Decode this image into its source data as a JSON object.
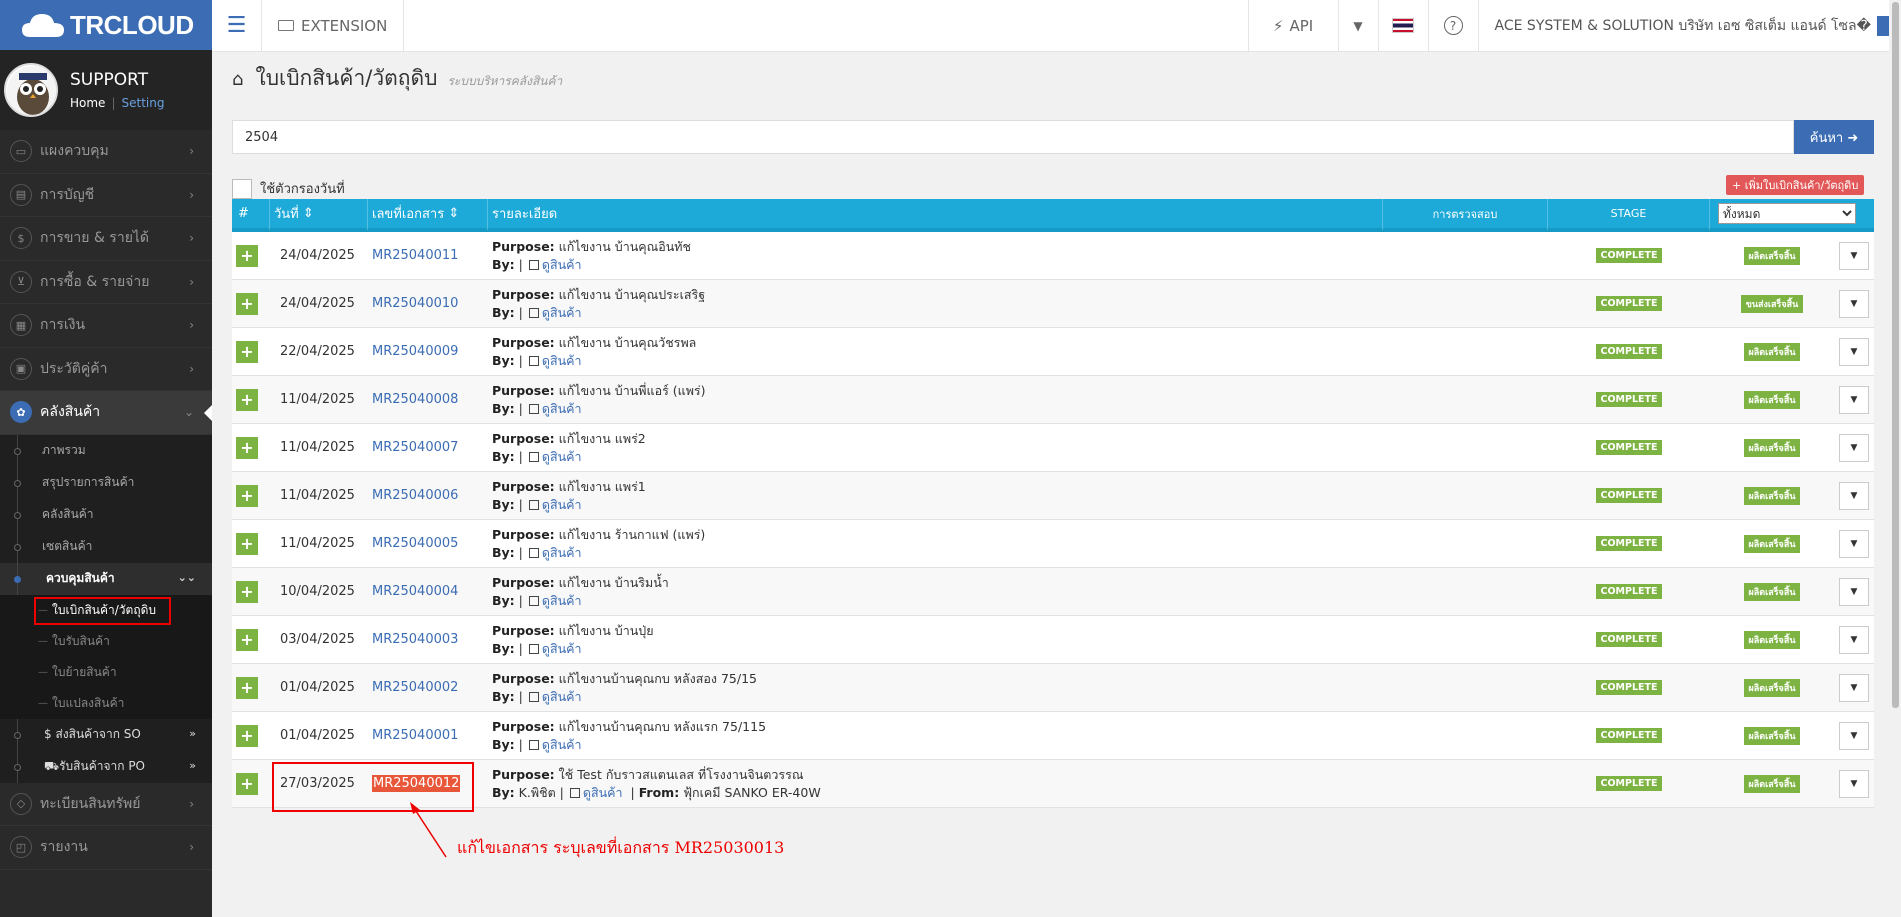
{
  "brand": {
    "logo_text": "TRCLOUD"
  },
  "profile": {
    "name": "SUPPORT",
    "home": "Home",
    "separator": "|",
    "setting": "Setting"
  },
  "sidebar": {
    "menu_top": [
      {
        "label": "แผงควบคุม",
        "icon": "monitor-icon"
      },
      {
        "label": "การบัญชี",
        "icon": "book-icon"
      },
      {
        "label": "การขาย & รายได้",
        "icon": "dollar-icon"
      },
      {
        "label": "การซื้อ & รายจ่าย",
        "icon": "cart-icon"
      },
      {
        "label": "การเงิน",
        "icon": "calendar-icon"
      },
      {
        "label": "ประวัติคู่ค้า",
        "icon": "contact-icon"
      }
    ],
    "warehouse": {
      "label": "คลังสินค้า",
      "icon": "warehouse-icon"
    },
    "warehouse_items": [
      "ภาพรวม",
      "สรุปรายการสินค้า",
      "คลังสินค้า",
      "เซตสินค้า"
    ],
    "control": {
      "label": "ควบคุมสินค้า"
    },
    "control_items": [
      "ใบเบิกสินค้า/วัตถุดิบ",
      "ใบรับสินค้า",
      "ใบย้ายสินค้า",
      "ใบแปลงสินค้า"
    ],
    "ship_so": "$ ส่งสินค้าจาก SO",
    "receive_po": "รับสินค้าจาก PO",
    "menu_bottom": [
      {
        "label": "ทะเบียนสินทรัพย์",
        "icon": "diamond-icon"
      },
      {
        "label": "รายงาน",
        "icon": "report-icon"
      }
    ]
  },
  "topbar": {
    "extension": "EXTENSION",
    "api": "API",
    "company": "ACE SYSTEM & SOLUTION บริษัท เอซ ซิสเต็ม แอนด์ โซล�"
  },
  "page": {
    "title": "ใบเบิกสินค้า/วัตถุดิบ",
    "subtitle": "ระบบบริหารคลังสินค้า"
  },
  "search": {
    "value": "2504",
    "button": "ค้นหา"
  },
  "filter": {
    "label": "ใช้ตัวกรองวันที่"
  },
  "add_button": "+ เพิ่มใบเบิกสินค้า/วัตถุดิบ",
  "table": {
    "headers": {
      "idx": "#",
      "date": "วันที่",
      "doc": "เลขที่เอกสาร",
      "detail": "รายละเอียด",
      "check": "การตรวจสอบ",
      "stage": "STAGE",
      "status_select": "ทั้งหมด"
    },
    "purpose_label": "Purpose:",
    "by_label": "By:",
    "see_items": "ดูสินค้า",
    "from_label": "From:",
    "rows": [
      {
        "date": "24/04/2025",
        "doc": "MR25040011",
        "purpose": "แก้ไขงาน บ้านคุณอินทัช",
        "by": "",
        "stage": "COMPLETE",
        "status": "ผลิตเสร็จสิ้น"
      },
      {
        "date": "24/04/2025",
        "doc": "MR25040010",
        "purpose": "แก้ไขงาน บ้านคุณประเสริฐ",
        "by": "",
        "stage": "COMPLETE",
        "status": "ขนส่งเสร็จสิ้น"
      },
      {
        "date": "22/04/2025",
        "doc": "MR25040009",
        "purpose": "แก้ไขงาน บ้านคุณวัชรพล",
        "by": "",
        "stage": "COMPLETE",
        "status": "ผลิตเสร็จสิ้น"
      },
      {
        "date": "11/04/2025",
        "doc": "MR25040008",
        "purpose": "แก้ไขงาน บ้านพี่แอร์ (แพร่)",
        "by": "",
        "stage": "COMPLETE",
        "status": "ผลิตเสร็จสิ้น"
      },
      {
        "date": "11/04/2025",
        "doc": "MR25040007",
        "purpose": "แก้ไขงาน แพร่2",
        "by": "",
        "stage": "COMPLETE",
        "status": "ผลิตเสร็จสิ้น"
      },
      {
        "date": "11/04/2025",
        "doc": "MR25040006",
        "purpose": "แก้ไขงาน แพร่1",
        "by": "",
        "stage": "COMPLETE",
        "status": "ผลิตเสร็จสิ้น"
      },
      {
        "date": "11/04/2025",
        "doc": "MR25040005",
        "purpose": "แก้ไขงาน ร้านกาแฟ (แพร่)",
        "by": "",
        "stage": "COMPLETE",
        "status": "ผลิตเสร็จสิ้น"
      },
      {
        "date": "10/04/2025",
        "doc": "MR25040004",
        "purpose": "แก้ไขงาน บ้านริมน้ำ",
        "by": "",
        "stage": "COMPLETE",
        "status": "ผลิตเสร็จสิ้น"
      },
      {
        "date": "03/04/2025",
        "doc": "MR25040003",
        "purpose": "แก้ไขงาน บ้านปุ่ย",
        "by": "",
        "stage": "COMPLETE",
        "status": "ผลิตเสร็จสิ้น"
      },
      {
        "date": "01/04/2025",
        "doc": "MR25040002",
        "purpose": "แก้ไขงานบ้านคุณกบ หลังสอง 75/15",
        "by": "",
        "stage": "COMPLETE",
        "status": "ผลิตเสร็จสิ้น"
      },
      {
        "date": "01/04/2025",
        "doc": "MR25040001",
        "purpose": "แก้ไขงานบ้านคุณกบ หลังแรก 75/115",
        "by": "",
        "stage": "COMPLETE",
        "status": "ผลิตเสร็จสิ้น"
      },
      {
        "date": "27/03/2025",
        "doc": "MR25040012",
        "purpose": "ใช้ Test กับราวสแตนเลส ที่โรงงานจินตวรรณ",
        "by": "K.พิชิต",
        "from": "ฟุ้กเคมี SANKO ER-40W",
        "stage": "COMPLETE",
        "status": "ผลิตเสร็จสิ้น",
        "highlight": true
      }
    ]
  },
  "annotation": "แก้ไขเอกสาร ระบุเลขที่เอกสาร MR25030013",
  "colors": {
    "primary": "#3b6cb4",
    "header": "#1eaad8",
    "success": "#7cb342",
    "danger": "#e25858",
    "highlight": "#e00000"
  }
}
